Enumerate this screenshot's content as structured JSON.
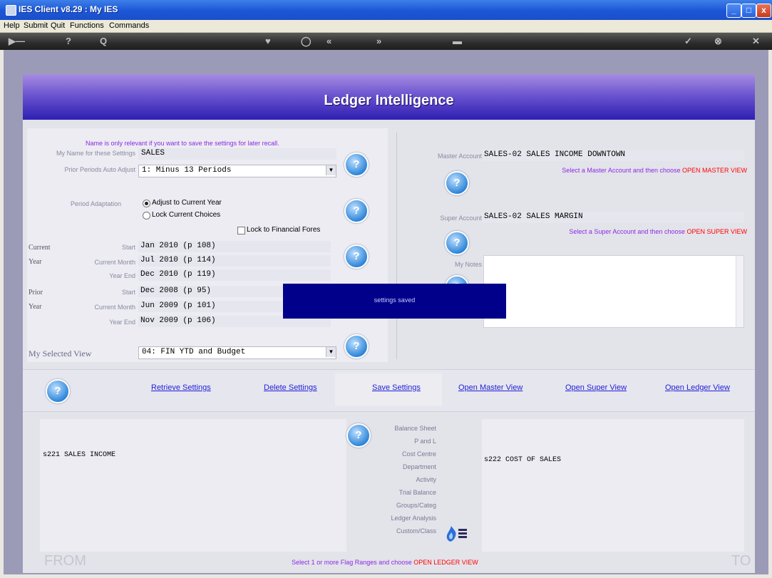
{
  "window": {
    "title": "IES Client v8.29 : My IES",
    "minimize": "_",
    "maximize": "□",
    "close": "x"
  },
  "menu": [
    "Help",
    "Submit",
    "Quit",
    "Functions",
    "Commands"
  ],
  "toolbar": {
    "back": "▶—",
    "help": "?",
    "search": "Q",
    "fav": "♥",
    "power": "◯",
    "prev": "«",
    "next": "»",
    "minimize": "▬",
    "ok": "✓",
    "cancel": "⊗",
    "close": "✕"
  },
  "header": {
    "title": "Ledger Intelligence"
  },
  "settings": {
    "note": "Name is only relevant if you want to save the settings for later recall.",
    "my_name_label": "My Name for these Settings",
    "my_name_value": "SALES",
    "prior_periods_label": "Prior Periods Auto Adjust",
    "prior_periods_value": "1: Minus 13 Periods",
    "period_adaptation_label": "Period Adaptation",
    "radio_adjust": "Adjust to Current Year",
    "radio_lock": "Lock Current Choices",
    "lock_forecast": "Lock to Financial Fores",
    "current_label": "Current",
    "year_label": "Year",
    "prior_label": "Prior",
    "start_label": "Start",
    "current_month_label": "Current Month",
    "year_end_label": "Year End",
    "current_start": "Jan 2010 (p 108)",
    "current_month": "Jul 2010 (p 114)",
    "current_end": "Dec 2010 (p 119)",
    "prior_start": "Dec 2008 (p 95)",
    "prior_month": "Jun 2009 (p 101)",
    "prior_end": "Nov 2009 (p 106)",
    "view_label": "My Selected View",
    "view_value": "04: FIN YTD and Budget"
  },
  "accounts": {
    "master_label": "Master Account",
    "master_value": "SALES-02 SALES INCOME DOWNTOWN",
    "master_hint_a": "Select a Master Account and then choose ",
    "master_hint_b": "OPEN MASTER VIEW",
    "super_label": "Super Account",
    "super_value": "SALES-02 SALES MARGIN",
    "super_hint_a": "Select a Super Account and then choose ",
    "super_hint_b": "OPEN SUPER VIEW",
    "notes_label": "My Notes"
  },
  "toast": "settings saved",
  "actions": {
    "retrieve": "Retrieve Settings",
    "delete": "Delete Settings",
    "save": "Save Settings",
    "master": "Open Master View",
    "super": "Open Super View",
    "ledger": "Open Ledger View"
  },
  "flags": {
    "from_value": "s221 SALES INCOME",
    "to_value": "s222 COST OF SALES",
    "items": [
      "Balance Sheet",
      "P and L",
      "Cost Centre",
      "Department",
      "Activity",
      "Trial Balance",
      "Groups/Categ",
      "Ledger Analysis",
      "Custom/Class"
    ],
    "from_label": "FROM",
    "to_label": "TO",
    "hint_a": "Select 1 or more Flag Ranges and choose ",
    "hint_b": "OPEN LEDGER VIEW"
  },
  "help_glyph": "?",
  "colors": {
    "header": "#2d1fb3",
    "toast": "#00008b",
    "link": "#1f1fd8",
    "hint_red": "#ff0000"
  }
}
